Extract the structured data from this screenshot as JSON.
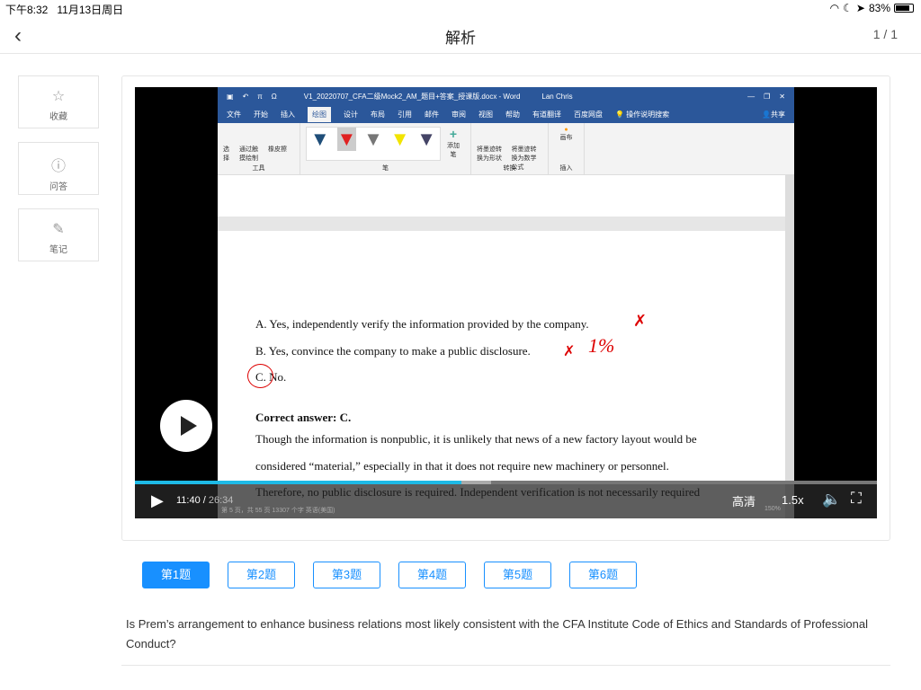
{
  "status": {
    "time": "下午8:32",
    "date": "11月13日周日",
    "battery": "83%"
  },
  "nav": {
    "title": "解析",
    "page": "1 / 1"
  },
  "side": [
    {
      "icon": "star",
      "label": "收藏"
    },
    {
      "icon": "question",
      "label": "问答"
    },
    {
      "icon": "edit",
      "label": "笔记"
    }
  ],
  "word": {
    "title": "V1_20220707_CFA二级Mock2_AM_题目+答案_授课版.docx - Word",
    "user": "Lan Chris",
    "tabs": [
      "文件",
      "开始",
      "插入",
      "绘图",
      "设计",
      "布局",
      "引用",
      "邮件",
      "审阅",
      "视图",
      "帮助",
      "有道翻译",
      "百度网盘",
      "操作说明搜索"
    ],
    "share": "共享",
    "groups": {
      "tools": "工具",
      "pens": "笔",
      "convert": "转换",
      "insert": "插入"
    },
    "tool_items": [
      "选择",
      "通过触摸绘制",
      "橡皮擦"
    ],
    "add_pen": "添加笔",
    "convert_items": [
      "将墨迹转换为形状",
      "将墨迹转换为数学公式"
    ],
    "canvas": "画布",
    "statusbar": "第 5 页，共 55 页   13307 个字   英语(美国)",
    "zoom": "150%"
  },
  "doc": {
    "a": "A.   Yes, independently verify the information provided by the company.",
    "b": "B.   Yes, convince the company to make a public disclosure.",
    "c": "C.   No.",
    "answer": "Correct answer: C.",
    "p1": "Though the information is nonpublic, it is unlikely that news of a new factory layout would be",
    "p2": "considered “material,” especially in that it does not require new machinery or personnel.",
    "p3": "Therefore, no public disclosure is required. Independent verification is not necessarily required",
    "mark": "1%"
  },
  "player": {
    "current": "11:40",
    "total": "26:34",
    "progress": 0.44,
    "buffered": 0.48,
    "quality": "高清",
    "speed": "1.5x"
  },
  "questions": [
    "第1题",
    "第2题",
    "第3题",
    "第4题",
    "第5题",
    "第6题"
  ],
  "question_text": "Is Prem’s arrangement to enhance business relations most likely consistent with the CFA Institute Code of Ethics and Standards of Professional Conduct?"
}
